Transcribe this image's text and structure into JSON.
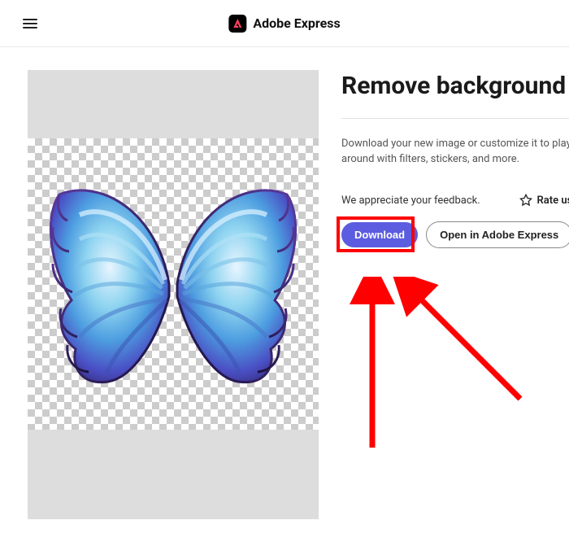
{
  "header": {
    "brand": "Adobe Express"
  },
  "panel": {
    "title": "Remove background",
    "description": "Download your new image or customize it to play around with filters, stickers, and more.",
    "feedback_text": "We appreciate your feedback.",
    "rate_label": "Rate us",
    "download_label": "Download",
    "open_label": "Open in Adobe Express"
  }
}
